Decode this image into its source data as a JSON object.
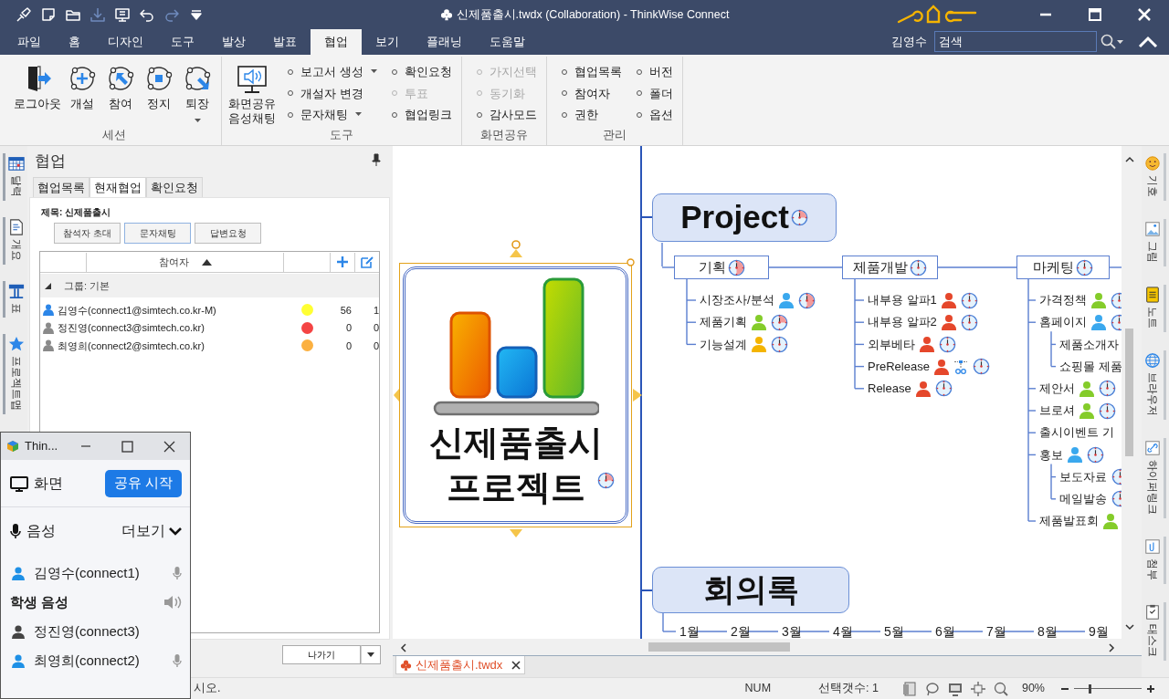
{
  "window": {
    "title": "신제품출시.twdx (Collaboration) -  ThinkWise Connect"
  },
  "quick_access": [
    {
      "kind": "brush",
      "disabled": false
    },
    {
      "kind": "note",
      "disabled": false
    },
    {
      "kind": "folder",
      "disabled": false
    },
    {
      "kind": "save",
      "disabled": true
    },
    {
      "kind": "present",
      "disabled": false
    },
    {
      "kind": "undo",
      "disabled": false
    },
    {
      "kind": "redo",
      "disabled": true
    },
    {
      "kind": "more",
      "disabled": false
    }
  ],
  "menu_tabs": [
    {
      "label": "파일",
      "selected": false
    },
    {
      "label": "홈",
      "selected": false
    },
    {
      "label": "디자인",
      "selected": false
    },
    {
      "label": "도구",
      "selected": false
    },
    {
      "label": "발상",
      "selected": false
    },
    {
      "label": "발표",
      "selected": false
    },
    {
      "label": "협업",
      "selected": true
    },
    {
      "label": "보기",
      "selected": false
    },
    {
      "label": "플래닝",
      "selected": false
    },
    {
      "label": "도움말",
      "selected": false
    }
  ],
  "user": "김영수",
  "search": {
    "placeholder": "검색"
  },
  "ribbon": {
    "groups": [
      {
        "label": "세션",
        "large": [
          {
            "label": "로그아웃",
            "kind": "logout",
            "dropdown": false
          },
          {
            "label": "개설",
            "kind": "open",
            "dropdown": false
          },
          {
            "label": "참여",
            "kind": "join",
            "dropdown": false
          },
          {
            "label": "정지",
            "kind": "stop",
            "dropdown": false
          },
          {
            "label": "퇴장",
            "kind": "leave",
            "dropdown": true
          }
        ]
      },
      {
        "label": "도구",
        "large": [
          {
            "label": "화면공유\n음성채팅",
            "kind": "share",
            "dropdown": false
          }
        ],
        "columns": [
          [
            {
              "label": "보고서 생성",
              "dropdown": true,
              "disabled": false
            },
            {
              "label": "개설자 변경",
              "dropdown": false,
              "disabled": false
            },
            {
              "label": "문자채팅",
              "dropdown": true,
              "disabled": false
            }
          ],
          [
            {
              "label": "확인요청",
              "dropdown": false,
              "disabled": false
            },
            {
              "label": "투표",
              "dropdown": false,
              "disabled": true
            },
            {
              "label": "협업링크",
              "dropdown": false,
              "disabled": false
            }
          ]
        ]
      },
      {
        "label": "화면공유",
        "columns": [
          [
            {
              "label": "가지선택",
              "dropdown": false,
              "disabled": true
            },
            {
              "label": "동기화",
              "dropdown": false,
              "disabled": true
            },
            {
              "label": "감사모드",
              "dropdown": false,
              "disabled": false
            }
          ]
        ]
      },
      {
        "label": "관리",
        "columns": [
          [
            {
              "label": "협업목록",
              "dropdown": false,
              "disabled": false
            },
            {
              "label": "참여자",
              "dropdown": false,
              "disabled": false
            },
            {
              "label": "권한",
              "dropdown": false,
              "disabled": false
            }
          ],
          [
            {
              "label": "버전",
              "dropdown": false,
              "disabled": false
            },
            {
              "label": "폴더",
              "dropdown": false,
              "disabled": false
            },
            {
              "label": "옵션",
              "dropdown": false,
              "disabled": false
            }
          ]
        ]
      }
    ]
  },
  "side_tabs": [
    {
      "label": "달력",
      "kind": "calendar"
    },
    {
      "label": "개요",
      "kind": "outline"
    },
    {
      "label": "표",
      "kind": "table"
    },
    {
      "label": "프로젝트맵",
      "kind": "star"
    }
  ],
  "panel": {
    "title": "협업",
    "tabs": [
      {
        "label": "협업목록",
        "selected": false
      },
      {
        "label": "현재협업",
        "selected": true
      },
      {
        "label": "확인요청",
        "selected": false
      }
    ],
    "subject": "제목: 신제품출시",
    "buttons": [
      "참석자 초대",
      "문자채팅",
      "답변요청"
    ],
    "column": "참여자",
    "group": {
      "label": "그룹: 기본",
      "expanded": true,
      "rows": [
        {
          "name": "김영수(connect1@simtech.co.kr-M)",
          "online": true,
          "color": "#ffff33",
          "count_1": "56",
          "count_2": "1"
        },
        {
          "name": "정진영(connect3@simtech.co.kr)",
          "online": false,
          "color": "#f44444",
          "count_1": "0",
          "count_2": "0"
        },
        {
          "name": "최영희(connect2@simtech.co.kr)",
          "online": false,
          "color": "#fbb040",
          "count_1": "0",
          "count_2": "0"
        }
      ]
    },
    "exit_button": "나가기"
  },
  "mindmap": {
    "central": {
      "title": "신제품출시\n프로젝트",
      "kind": "quarter",
      "selected": true
    },
    "project": {
      "title": "Project",
      "kind": "quarter",
      "branches": [
        {
          "title": "기획",
          "kind": "half",
          "items": [
            {
              "label": "시장조사/분석",
              "color": "#3aa8ee",
              "kind": "half"
            },
            {
              "label": "제품기획",
              "color": "#84cc2a",
              "kind": "quarter"
            },
            {
              "label": "기능설계",
              "color": "#f4b400",
              "kind": "empty"
            }
          ]
        },
        {
          "title": "제품개발",
          "kind": "empty",
          "items": [
            {
              "label": "내부용 알파1",
              "color": "#e5472b",
              "kind": "empty"
            },
            {
              "label": "내부용 알파2",
              "color": "#e5472b",
              "kind": "empty"
            },
            {
              "label": "외부베타",
              "color": "#e5472b",
              "kind": "empty"
            },
            {
              "label": "PreRelease",
              "color": "#e5472b",
              "relation": true,
              "kind": "empty"
            },
            {
              "label": "Release",
              "color": "#e5472b",
              "kind": "empty"
            }
          ]
        },
        {
          "title": "마케팅",
          "kind": "empty",
          "items": [
            {
              "label": "가격정책",
              "color": "#84cc2a",
              "kind": "empty"
            },
            {
              "label": "홈페이지",
              "color": "#3aa8ee",
              "kind": "empty",
              "children": [
                {
                  "label": "제품소개자",
                  "kind": "plain"
                },
                {
                  "label": "쇼핑몰 제품",
                  "kind": "plain"
                }
              ]
            },
            {
              "label": "제안서",
              "color": "#84cc2a",
              "kind": "empty"
            },
            {
              "label": "브로셔",
              "color": "#84cc2a",
              "kind": "empty"
            },
            {
              "label": "출시이벤트 기",
              "kind": "plain"
            },
            {
              "label": "홍보",
              "color": "#3aa8ee",
              "kind": "empty",
              "children": [
                {
                  "label": "보도자료",
                  "kind": "empty"
                },
                {
                  "label": "메일발송",
                  "kind": "empty"
                }
              ]
            },
            {
              "label": "제품발표회",
              "color": "#84cc2a",
              "kind": "plain"
            }
          ]
        }
      ]
    },
    "minutes": {
      "title": "회의록",
      "months": [
        "1월",
        "2월",
        "3월",
        "4월",
        "5월",
        "6월",
        "7월",
        "8월",
        "9월"
      ]
    }
  },
  "right_tabs": [
    {
      "label": "기호",
      "kind": "symbol"
    },
    {
      "label": "그림",
      "kind": "image"
    },
    {
      "label": "노트",
      "kind": "note"
    },
    {
      "label": "브라우저",
      "kind": "globe"
    },
    {
      "label": "하이퍼링크",
      "kind": "link"
    },
    {
      "label": "첨부",
      "kind": "attach"
    },
    {
      "label": "태스크",
      "kind": "task"
    }
  ],
  "doc_tabs": [
    {
      "label": "신제품출시.twdx",
      "selected": true
    }
  ],
  "status_bar": {
    "message": "시오.",
    "num": "NUM",
    "selection": "선택갯수: 1",
    "zoom": "90%",
    "zoom_slider": {
      "level": 0.23
    }
  },
  "voice_window": {
    "title": "Thin...",
    "screen": {
      "label": "화면",
      "button": "공유 시작"
    },
    "voice": {
      "label": "음성",
      "more": "더보기"
    },
    "members": [
      {
        "kind": "user",
        "label": "김영수(connect1)",
        "online": true,
        "mic": true
      },
      {
        "kind": "header",
        "label": "학생 음성"
      },
      {
        "kind": "user",
        "label": "정진영(connect3)",
        "online": false,
        "mic": false
      },
      {
        "kind": "user",
        "label": "최영희(connect2)",
        "online": true,
        "mic": true
      }
    ]
  }
}
